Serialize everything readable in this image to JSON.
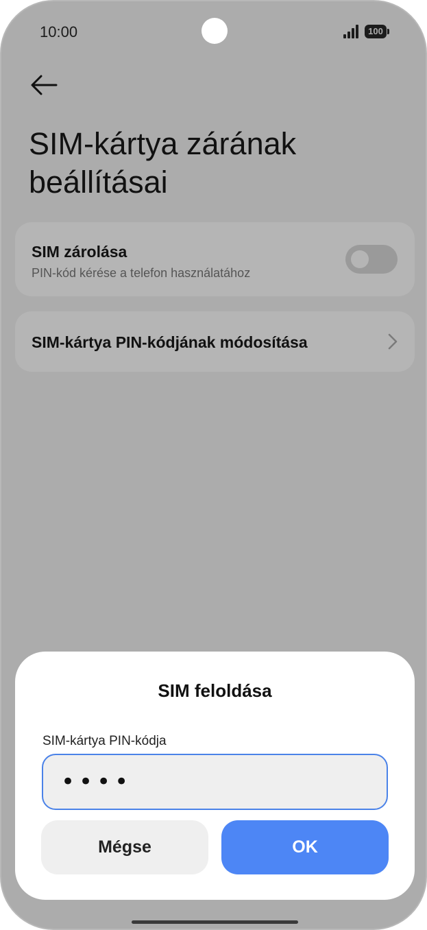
{
  "status_bar": {
    "time": "10:00",
    "battery_level": "100",
    "signal_icon": "signal-bars-icon",
    "battery_icon": "battery-icon"
  },
  "header": {
    "back_icon": "arrow-left-icon",
    "title": "SIM-kártya zárának beállításai"
  },
  "settings": {
    "sim_lock": {
      "title": "SIM zárolása",
      "subtitle": "PIN-kód kérése a telefon használatához",
      "toggle_state": "off"
    },
    "change_pin": {
      "title": "SIM-kártya PIN-kódjának módosítása",
      "icon": "chevron-right-icon"
    }
  },
  "dialog": {
    "title": "SIM feloldása",
    "field_label": "SIM-kártya PIN-kódja",
    "pin_value": "••••",
    "cancel_label": "Mégse",
    "ok_label": "OK"
  },
  "colors": {
    "scrim_background": "#acacac",
    "card_background": "#b5b5b5",
    "accent": "#4d86f5",
    "input_border": "#4a82e8"
  }
}
